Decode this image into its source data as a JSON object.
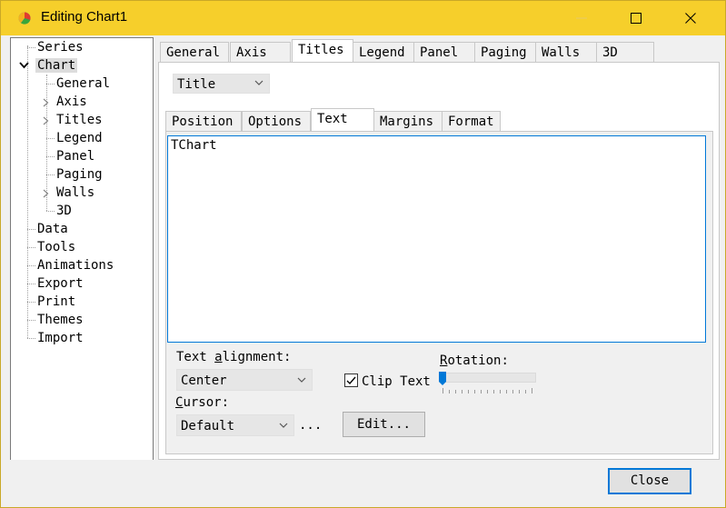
{
  "window": {
    "title": "Editing Chart1"
  },
  "tree": {
    "items": [
      {
        "label": "Series"
      },
      {
        "label": "Chart"
      },
      {
        "label": "General"
      },
      {
        "label": "Axis"
      },
      {
        "label": "Titles"
      },
      {
        "label": "Legend"
      },
      {
        "label": "Panel"
      },
      {
        "label": "Paging"
      },
      {
        "label": "Walls"
      },
      {
        "label": "3D"
      },
      {
        "label": "Data"
      },
      {
        "label": "Tools"
      },
      {
        "label": "Animations"
      },
      {
        "label": "Export"
      },
      {
        "label": "Print"
      },
      {
        "label": "Themes"
      },
      {
        "label": "Import"
      }
    ],
    "selected": "Chart"
  },
  "top_tabs": [
    {
      "label": "General"
    },
    {
      "label": "Axis"
    },
    {
      "label": "Titles"
    },
    {
      "label": "Legend"
    },
    {
      "label": "Panel"
    },
    {
      "label": "Paging"
    },
    {
      "label": "Walls"
    },
    {
      "label": "3D"
    }
  ],
  "top_tabs_active": "Titles",
  "title_select": {
    "value": "Title"
  },
  "sub_tabs": [
    {
      "label": "Position"
    },
    {
      "label": "Options"
    },
    {
      "label": "Text"
    },
    {
      "label": "Margins"
    },
    {
      "label": "Format"
    }
  ],
  "sub_tabs_active": "Text",
  "memo": {
    "text": "TChart"
  },
  "text_alignment": {
    "label_pre": "Text ",
    "label_accel": "a",
    "label_post": "lignment:",
    "value": "Center"
  },
  "cursor": {
    "label_accel": "C",
    "label_post": "ursor:",
    "value": "Default",
    "ellipsis": "..."
  },
  "clip_text": {
    "label": "Clip Text",
    "checked": true
  },
  "rotation": {
    "label_accel": "R",
    "label_post": "otation:",
    "value": 0
  },
  "edit_button": {
    "label": "Edit..."
  },
  "close_button": {
    "label": "Close"
  },
  "colors": {
    "titlebar": "#f6cf2b",
    "accent": "#0078d7"
  }
}
